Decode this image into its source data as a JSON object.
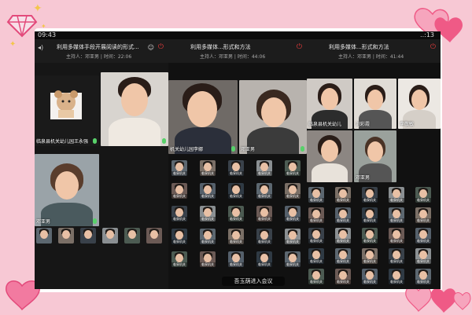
{
  "status_bar": {
    "time": "09:43",
    "right_text": "..:13"
  },
  "meetings": [
    {
      "title": "利用多媒体手段开展阅读的形式...",
      "host_label": "主持人：邓亚男",
      "time_label": "时间：22:06",
      "tiles": [
        {
          "name": "临泉县机关幼儿园王永强"
        },
        {
          "name": ""
        },
        {
          "name": "邓亚男"
        }
      ]
    },
    {
      "title": "利用多媒体...形式和方法",
      "host_label": "主持人：邓亚男",
      "time_label": "时间：44:06",
      "tiles": [
        {
          "name": "机关幼儿园李娜"
        },
        {
          "name": "邓亚男"
        }
      ],
      "toast": "吾玉荫进入会议"
    },
    {
      "title": "利用多媒体...形式和方法",
      "host_label": "主持人：邓亚男",
      "time_label": "时间：41:44",
      "tiles": [
        {
          "name": "临泉县机关幼儿"
        },
        {
          "name": "刘彩霞"
        },
        {
          "name": "李敬敏"
        },
        {
          "name": ""
        },
        {
          "name": "邓亚男"
        }
      ]
    }
  ],
  "thumb_label": "临泉机关",
  "colors": {
    "frame_pink": "#f7c8d4",
    "heart_pink": "#ef5a86",
    "mic_green": "#58d16a",
    "end_red": "#e23b3b"
  }
}
